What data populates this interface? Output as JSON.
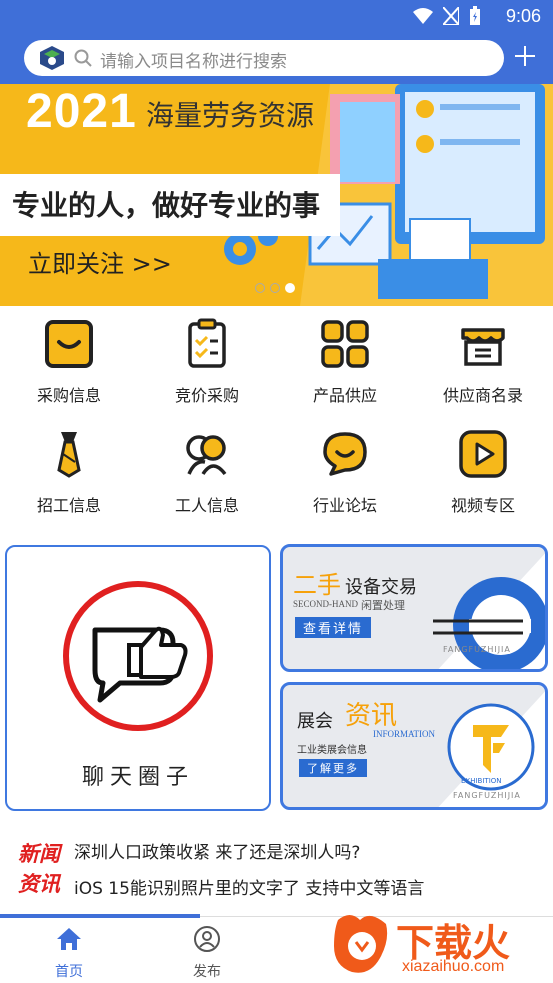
{
  "status": {
    "time": "9:06"
  },
  "search": {
    "placeholder": "请输入项目名称进行搜索"
  },
  "banner": {
    "year": "2021",
    "title": "海量劳务资源",
    "slogan": "专业的人，做好专业的事",
    "cta": "立即关注 >>",
    "active_dot": 2
  },
  "grid": [
    {
      "label": "采购信息",
      "icon": "shopping-bag-icon"
    },
    {
      "label": "竞价采购",
      "icon": "clipboard-icon"
    },
    {
      "label": "产品供应",
      "icon": "apps-grid-icon"
    },
    {
      "label": "供应商名录",
      "icon": "store-icon"
    },
    {
      "label": "招工信息",
      "icon": "tie-icon"
    },
    {
      "label": "工人信息",
      "icon": "workers-icon"
    },
    {
      "label": "行业论坛",
      "icon": "chat-bubble-icon"
    },
    {
      "label": "视频专区",
      "icon": "play-icon"
    }
  ],
  "cards": {
    "chat": {
      "title": "聊天圈子"
    },
    "secondhand": {
      "t1": "二手",
      "t2": "设备交易",
      "sub_en": "SECOND-HAND",
      "sub_cn": "闲置处理",
      "btn": "查看详情",
      "brand": "FANGFUZHIJIA"
    },
    "expo": {
      "t1": "展会",
      "t2": "资讯",
      "sub_en": "INFORMATION",
      "sub_cn": "工业类展会信息",
      "btn": "了解更多",
      "brand": "FANGFUZHIJIA",
      "badge": "EXHIBITION"
    }
  },
  "news": {
    "tag1": "新闻",
    "tag2": "资讯",
    "items": [
      "深圳人口政策收紧 来了还是深圳人吗?",
      "iOS 15能识别照片里的文字了 支持中文等语言"
    ]
  },
  "tabs": [
    {
      "label": "首页",
      "active": true
    },
    {
      "label": "发布",
      "active": false
    }
  ],
  "watermark": {
    "brand": "下载火",
    "site": "xiazaihuo.com"
  },
  "colors": {
    "primary": "#3f6fd8",
    "accent": "#f6b81a",
    "red": "#e02020",
    "orange": "#f05a1a"
  }
}
